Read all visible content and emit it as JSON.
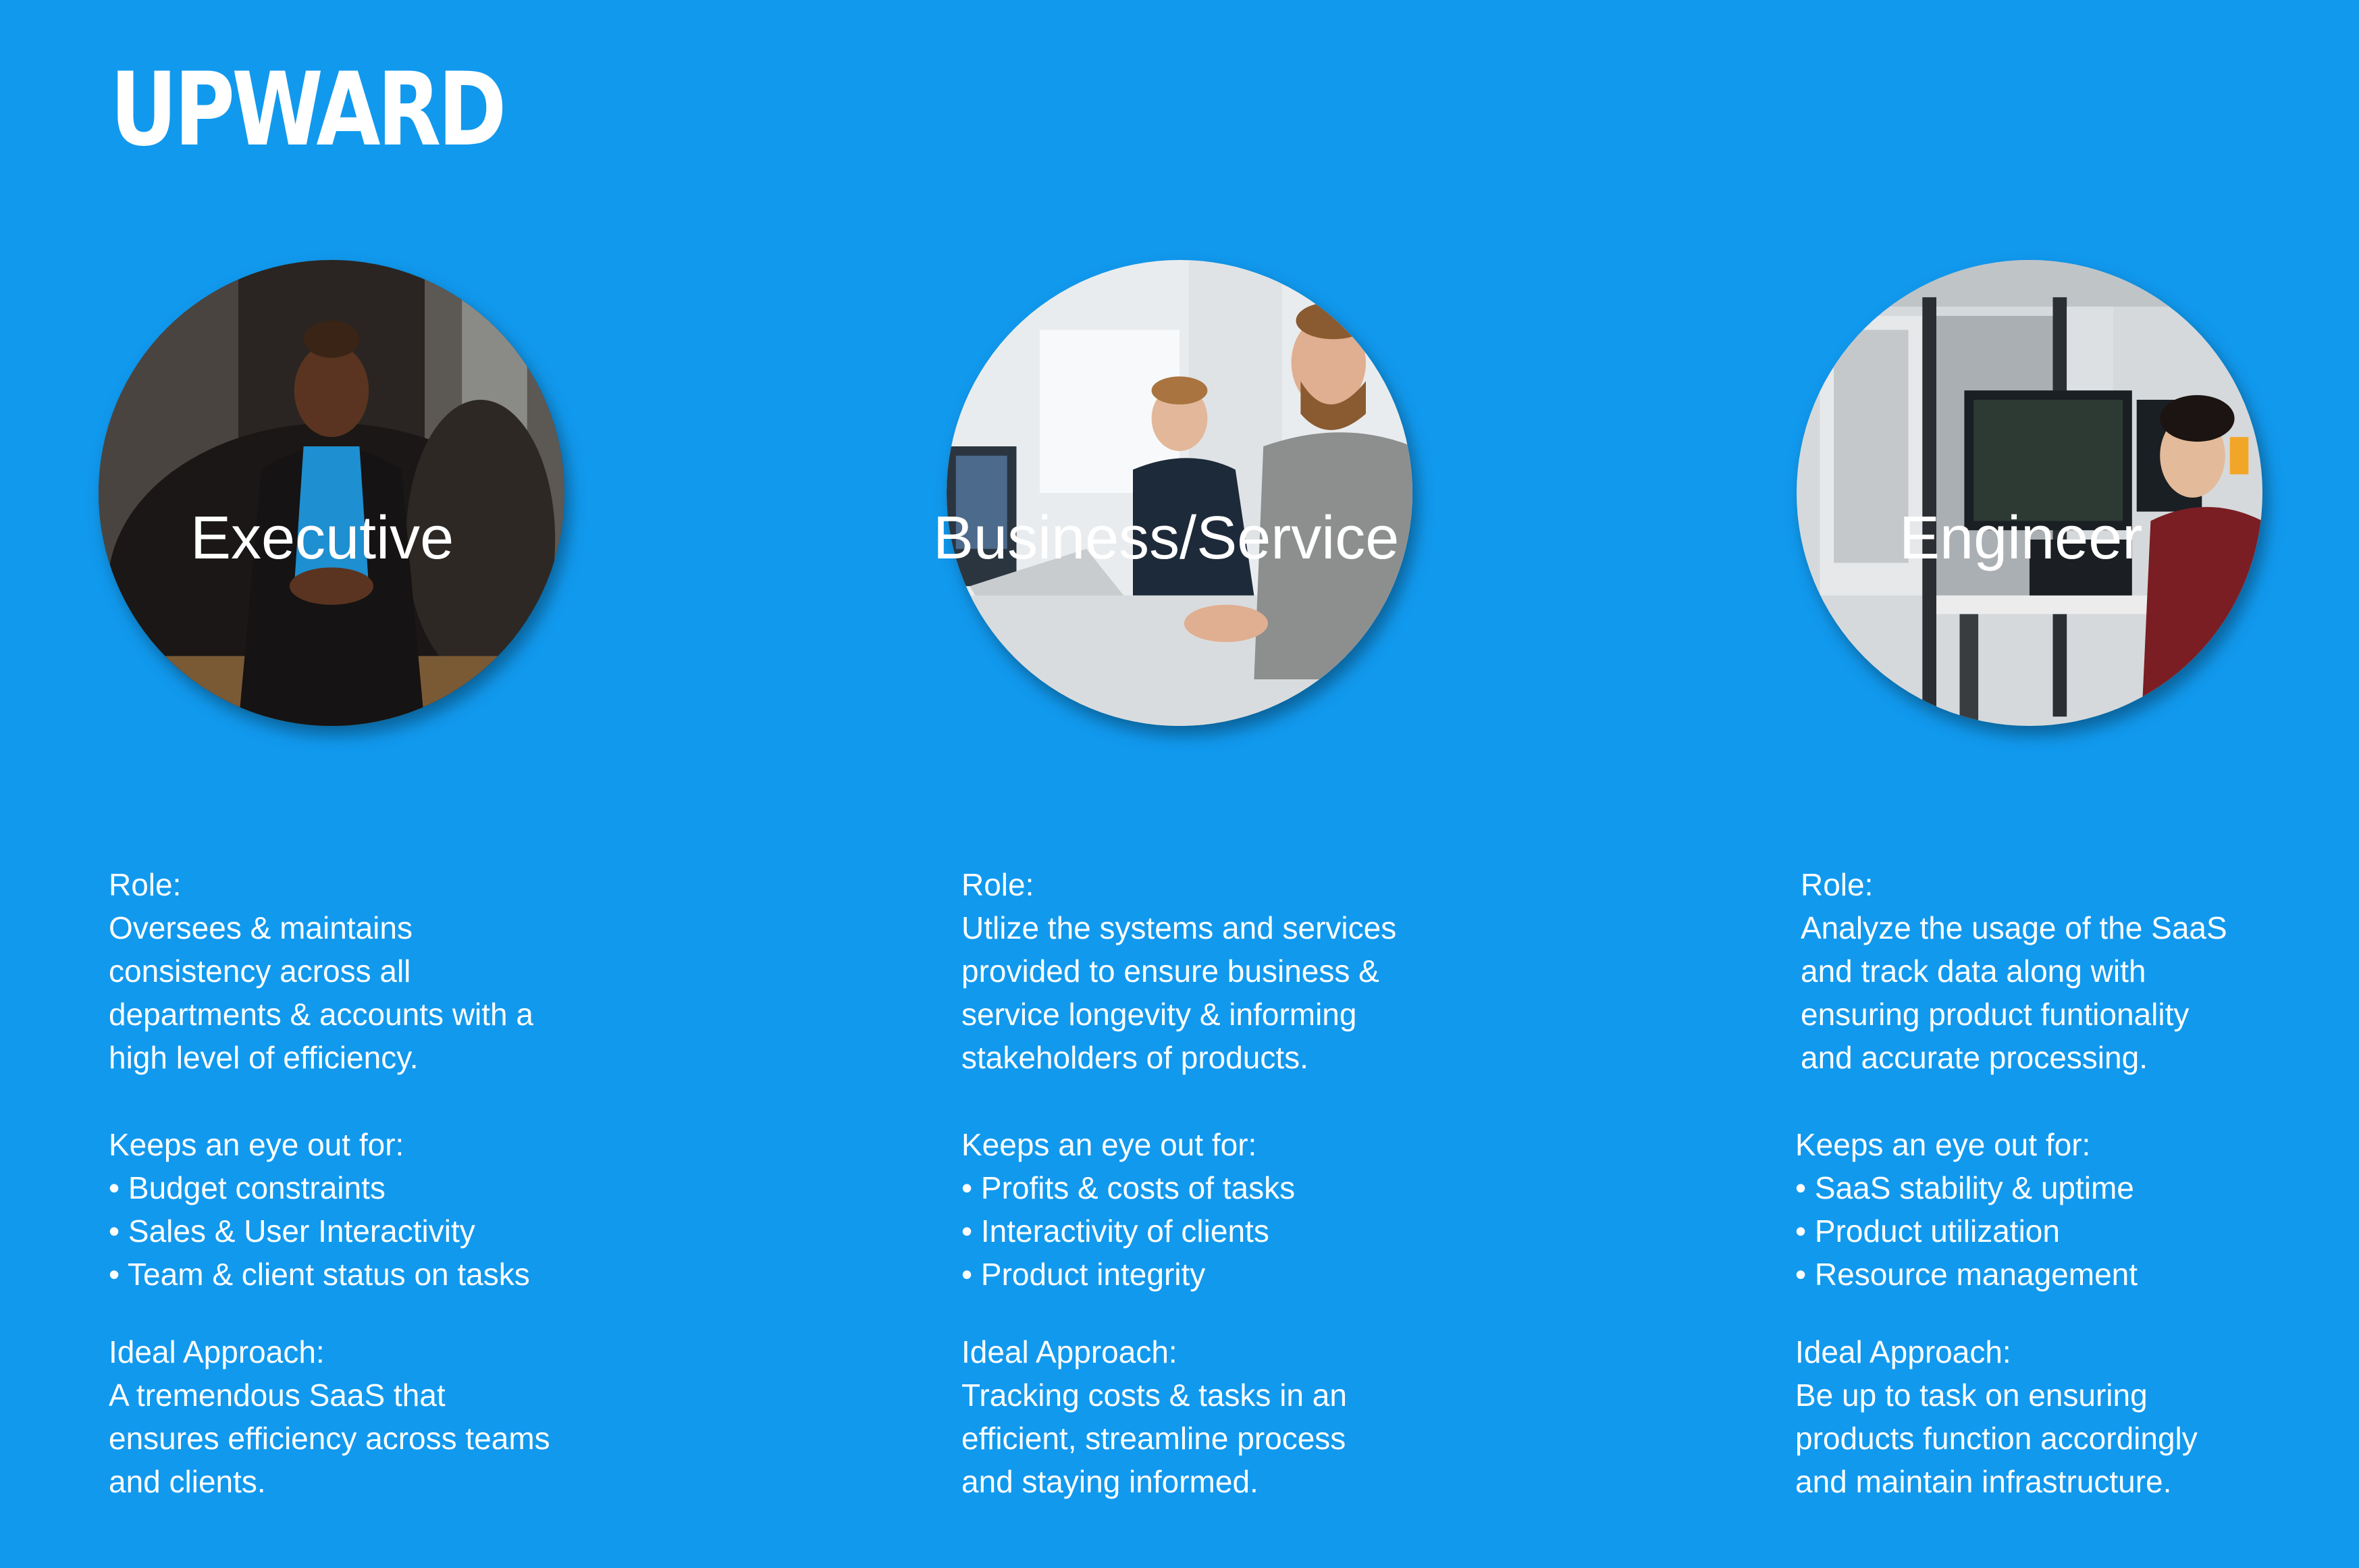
{
  "brand": {
    "logo_text": "UPWARD",
    "background_color": "#1199ee",
    "text_color": "#ffffff"
  },
  "personas": [
    {
      "title": "Executive",
      "photo_alt": "photo-executive",
      "role_heading": "Role:",
      "role_lines": [
        "Oversees & maintains",
        "consistency across all",
        "departments & accounts with a",
        "high level of efficiency."
      ],
      "eye_heading": "Keeps an eye out for:",
      "eye_items": [
        "• Budget constraints",
        "• Sales & User Interactivity",
        "• Team & client status on tasks"
      ],
      "approach_heading": "Ideal Approach:",
      "approach_lines": [
        "A tremendous SaaS that",
        "ensures efficiency across teams",
        "and clients."
      ]
    },
    {
      "title": "Business/Service",
      "photo_alt": "photo-business-service",
      "role_heading": "Role:",
      "role_lines": [
        "Utlize the systems and services",
        "provided to ensure business &",
        "service longevity & informing",
        "stakeholders of products."
      ],
      "eye_heading": "Keeps an eye out for:",
      "eye_items": [
        "• Profits & costs of tasks",
        "• Interactivity of clients",
        "• Product integrity"
      ],
      "approach_heading": "Ideal Approach:",
      "approach_lines": [
        "Tracking costs & tasks in an",
        "efficient, streamline process",
        "and staying informed."
      ]
    },
    {
      "title": "Engineer",
      "photo_alt": "photo-engineer",
      "role_heading": "Role:",
      "role_lines": [
        "Analyze the usage of the SaaS",
        "and track data along with",
        "ensuring product funtionality",
        "and accurate processing."
      ],
      "eye_heading": "Keeps an eye out for:",
      "eye_items": [
        "• SaaS stability & uptime",
        "• Product utilization",
        "• Resource management"
      ],
      "approach_heading": "Ideal Approach:",
      "approach_lines": [
        "Be up to task on ensuring",
        "products function accordingly",
        "and maintain infrastructure."
      ]
    }
  ]
}
